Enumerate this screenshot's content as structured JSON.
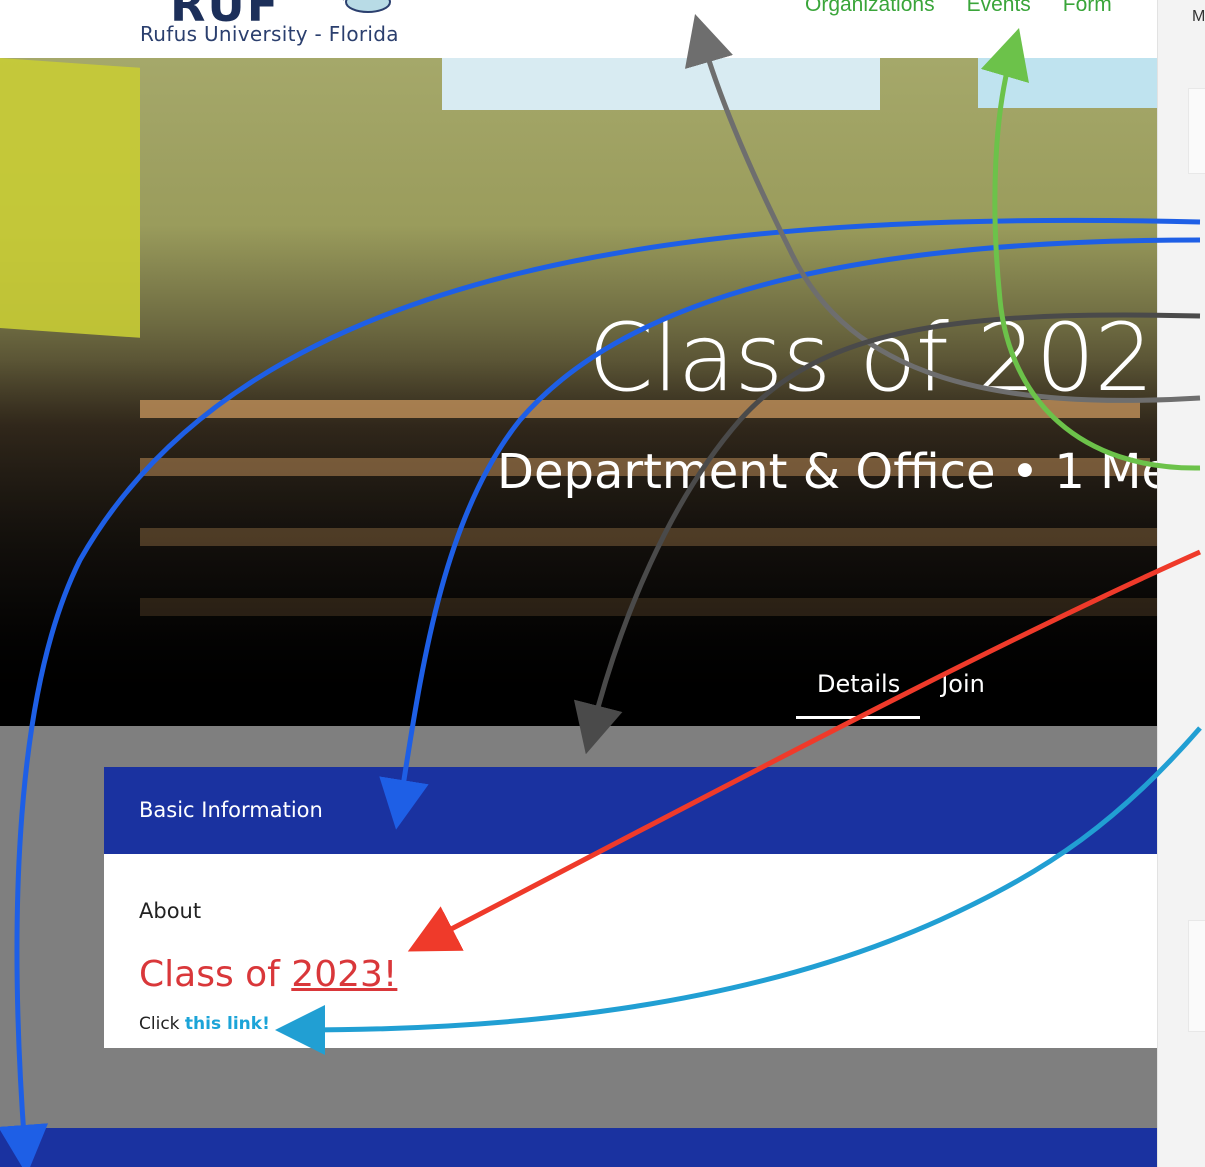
{
  "header": {
    "logo_text": "RUF",
    "logo_subtitle": "Rufus University - Florida",
    "nav": [
      {
        "label": "Organizations"
      },
      {
        "label": "Events"
      },
      {
        "label": "Form"
      }
    ]
  },
  "hero": {
    "title": "Class of 202",
    "subtitle": "Department & Office • 1 Me",
    "tabs": [
      {
        "label": "Details",
        "active": true
      },
      {
        "label": "Join",
        "active": false
      }
    ]
  },
  "card": {
    "header": "Basic Information",
    "about_label": "About",
    "heading_prefix": "Class of ",
    "heading_link": "2023!",
    "click_prefix": "Click ",
    "click_link": "this link!"
  },
  "side_panel": {
    "top_text": "M"
  },
  "colors": {
    "accent_blue": "#1a32a0",
    "nav_green": "#3aa53a",
    "heading_red": "#d9373a",
    "link_cyan": "#1ba4d8",
    "arrow_blue": "#1e5fe6",
    "arrow_grey": "#6e6e6e",
    "arrow_green": "#6cc24a",
    "arrow_red": "#ef3a2a",
    "arrow_cyan": "#219fd3"
  }
}
